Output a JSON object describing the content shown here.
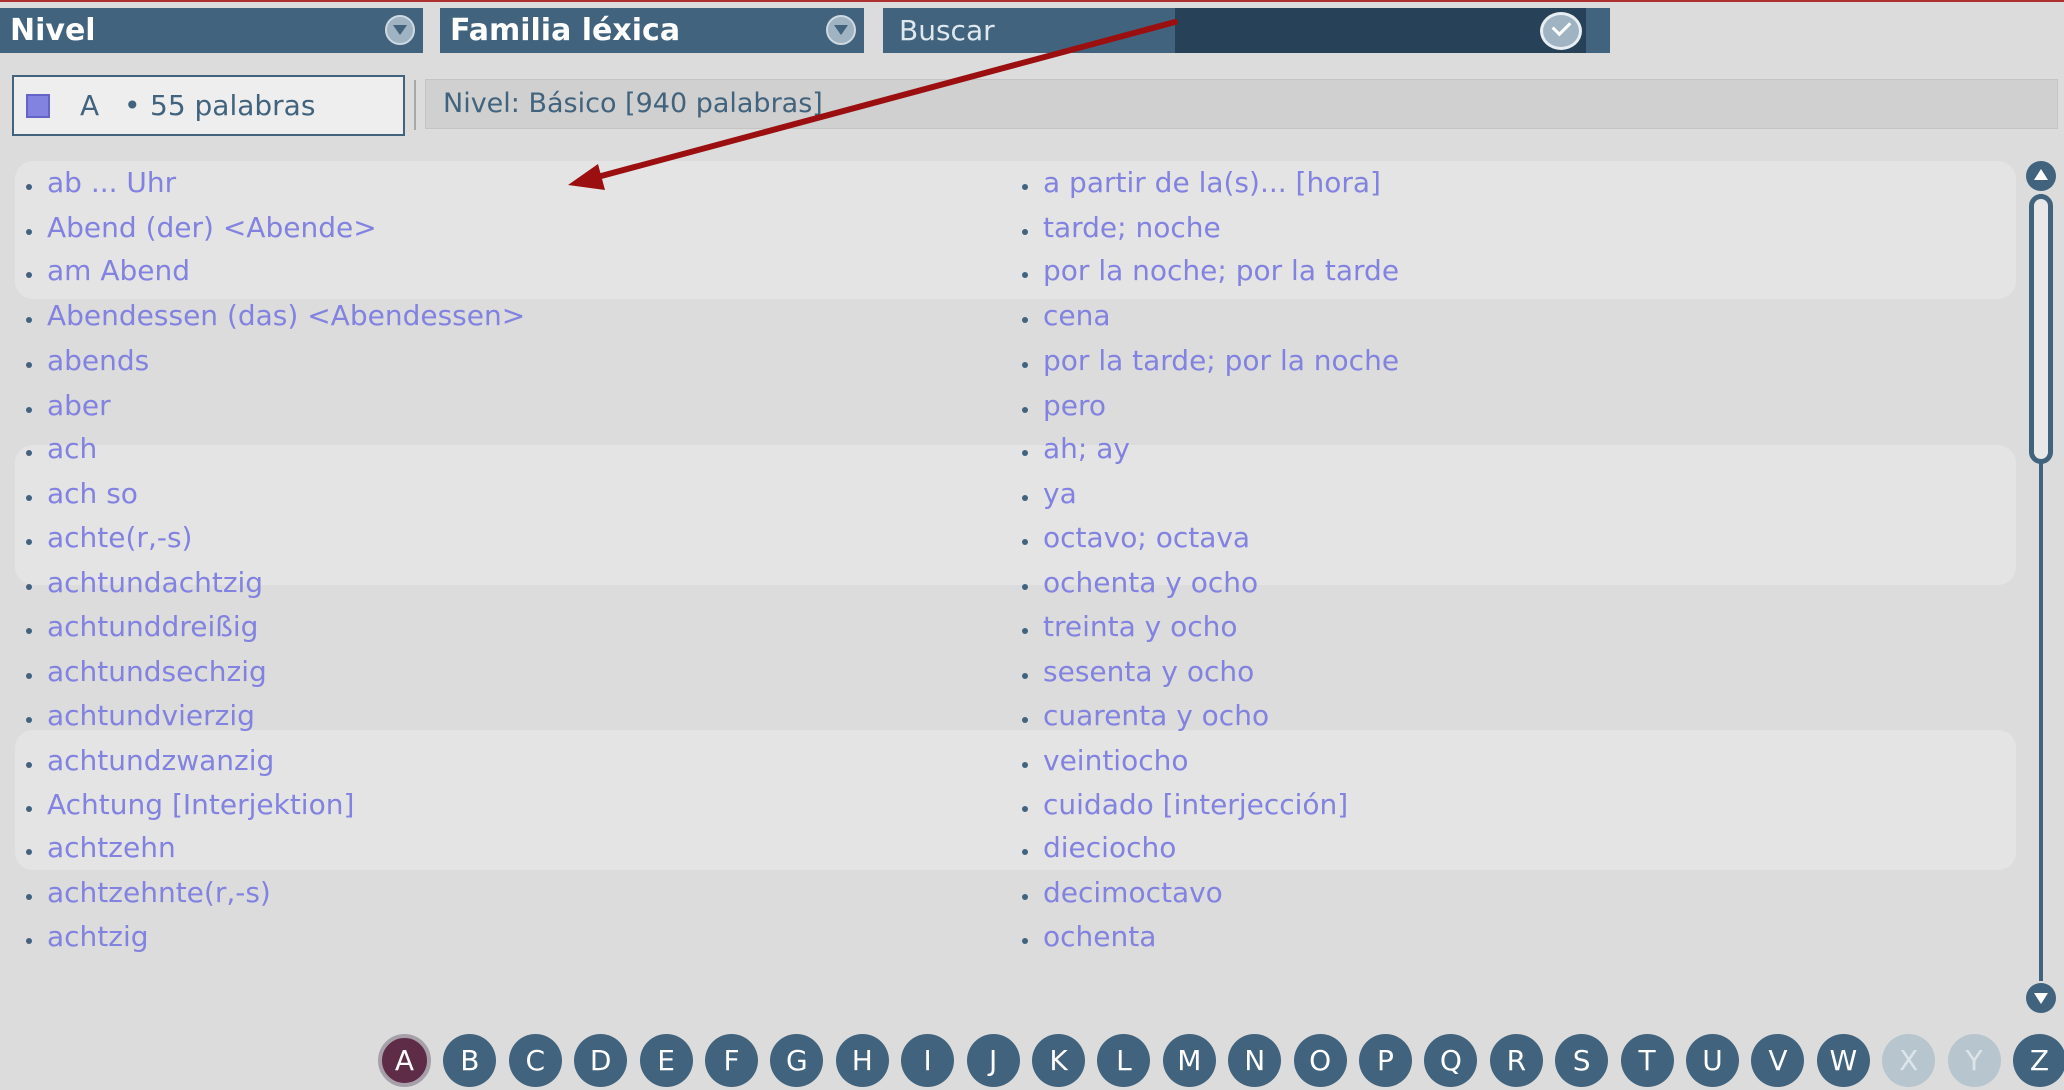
{
  "header": {
    "nivel_label": "Nivel",
    "familia_label": "Familia léxica",
    "search_placeholder": "Buscar"
  },
  "letter_info": {
    "current_letter": "A",
    "bullet": "•",
    "word_count": "55 palabras"
  },
  "level_info": "Nivel: Básico [940 palabras]",
  "words": [
    {
      "de": "ab ... Uhr",
      "es": "a partir de la(s)... [hora]"
    },
    {
      "de": "Abend (der) <Abende>",
      "es": "tarde; noche"
    },
    {
      "de": "am Abend",
      "es": "por la noche; por la tarde"
    },
    {
      "de": "Abendessen (das) <Abendessen>",
      "es": "cena"
    },
    {
      "de": "abends",
      "es": "por la tarde; por la noche"
    },
    {
      "de": "aber",
      "es": "pero"
    },
    {
      "de": "ach",
      "es": "ah; ay"
    },
    {
      "de": "ach so",
      "es": "ya"
    },
    {
      "de": "achte(r,-s)",
      "es": "octavo; octava"
    },
    {
      "de": "achtundachtzig",
      "es": "ochenta y ocho"
    },
    {
      "de": "achtunddreißig",
      "es": "treinta y ocho"
    },
    {
      "de": "achtundsechzig",
      "es": "sesenta y ocho"
    },
    {
      "de": "achtundvierzig",
      "es": "cuarenta y ocho"
    },
    {
      "de": "achtundzwanzig",
      "es": "veintiocho"
    },
    {
      "de": "Achtung [Interjektion]",
      "es": "cuidado [interjección]"
    },
    {
      "de": "achtzehn",
      "es": "dieciocho"
    },
    {
      "de": "achtzehnte(r,-s)",
      "es": "decimoctavo"
    },
    {
      "de": "achtzig",
      "es": "ochenta"
    }
  ],
  "alphabet": [
    "A",
    "B",
    "C",
    "D",
    "E",
    "F",
    "G",
    "H",
    "I",
    "J",
    "K",
    "L",
    "M",
    "N",
    "O",
    "P",
    "Q",
    "R",
    "S",
    "T",
    "U",
    "V",
    "W",
    "X",
    "Y",
    "Z"
  ],
  "alphabet_active": "A",
  "alphabet_disabled": [
    "X",
    "Y"
  ],
  "colors": {
    "header_bg": "#41637d",
    "search_dark": "#274258",
    "word_text": "#8282e0",
    "active_letter": "#5e2c46",
    "annotation_arrow": "#9b0f10"
  }
}
